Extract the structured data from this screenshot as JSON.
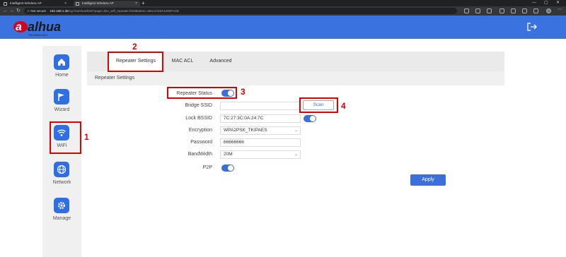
{
  "browser": {
    "tabs": [
      {
        "title": "Intelligent Wireless AP",
        "close": "×"
      },
      {
        "title": "Intelligent Wireless AP",
        "close": "×"
      }
    ],
    "new_tab": "+",
    "window_controls": {
      "minimize": "—",
      "maximize": "▢",
      "close": "✕"
    },
    "security_label": "Not secure",
    "url_host": "192.168.1.36",
    "url_path": "/cgi-bin/showhtml?page=dev_wifi_repeater.html&token=3B1ACD3A1292FACE",
    "nav": {
      "back": "←",
      "forward": "→",
      "reload": "↻"
    }
  },
  "brand": {
    "logo_text": "alhua",
    "logo_sub": "TECHNOLOGY",
    "accent": "#3a73e0",
    "logo_red": "#d6001c"
  },
  "sidebar": {
    "items": [
      {
        "label": "Home",
        "icon": "home-icon"
      },
      {
        "label": "Wizard",
        "icon": "flag-icon"
      },
      {
        "label": "WiFi",
        "icon": "wifi-icon"
      },
      {
        "label": "Network",
        "icon": "globe-icon"
      },
      {
        "label": "Manage",
        "icon": "gear-icon"
      }
    ]
  },
  "tabs": [
    {
      "label": "Repeater Settings",
      "active": true
    },
    {
      "label": "MAC ACL",
      "active": false
    },
    {
      "label": "Advanced",
      "active": false
    }
  ],
  "section_title": "Repeater Settings",
  "form": {
    "repeater_status_label": "Repeater Status",
    "repeater_status_on": true,
    "bridge_ssid_label": "Bridge SSID",
    "bridge_ssid_value": "",
    "scan_label": "Scan",
    "lock_bssid_label": "Lock BSSID",
    "lock_bssid_value": "7C:27:3C:0A:24:7C",
    "lock_bssid_on": true,
    "encryption_label": "Encryption",
    "encryption_value": "WPA2PSK_TKIPAES",
    "password_label": "Password",
    "password_value": "66666666",
    "bandwidth_label": "BandWidth",
    "bandwidth_value": "20M",
    "p2p_label": "P2P",
    "p2p_on": true,
    "apply_label": "Apply"
  },
  "annotations": [
    "1",
    "2",
    "3",
    "4"
  ]
}
